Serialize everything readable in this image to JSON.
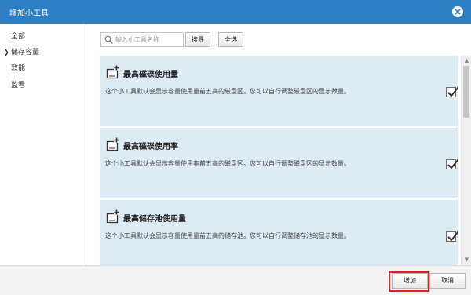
{
  "window": {
    "title": "增加小工具",
    "close_icon": "close-circle-icon"
  },
  "sidebar": {
    "items": [
      {
        "label": "全部",
        "selected": false
      },
      {
        "label": "储存容量",
        "selected": true
      },
      {
        "label": "效能",
        "selected": false
      },
      {
        "label": "监看",
        "selected": false
      }
    ]
  },
  "search": {
    "placeholder": "输入小工具名称",
    "value": "",
    "search_label": "搜寻",
    "select_all_label": "全选"
  },
  "cards": [
    {
      "title": "最高磁碟使用量",
      "description": "这个小工具默认会显示容量使用量前五高的磁盘区。您可以自行调整磁盘区的显示数量。",
      "checked": true,
      "icon": "widget-add-icon"
    },
    {
      "title": "最高磁碟使用率",
      "description": "这个小工具默认会显示容量使用率前五高的磁盘区。您可以自行调整磁盘区的显示数量。",
      "checked": true,
      "icon": "widget-add-icon"
    },
    {
      "title": "最高储存池使用量",
      "description": "这个小工具默认会显示容量使用量前五高的储存池。您可以自行调整储存池的显示数量。",
      "checked": true,
      "icon": "widget-add-icon"
    }
  ],
  "footer": {
    "add_label": "增加",
    "cancel_label": "取消"
  },
  "colors": {
    "titlebar": "#2d7fc3",
    "card_bg": "#ddebf5",
    "highlight": "#e02020"
  }
}
